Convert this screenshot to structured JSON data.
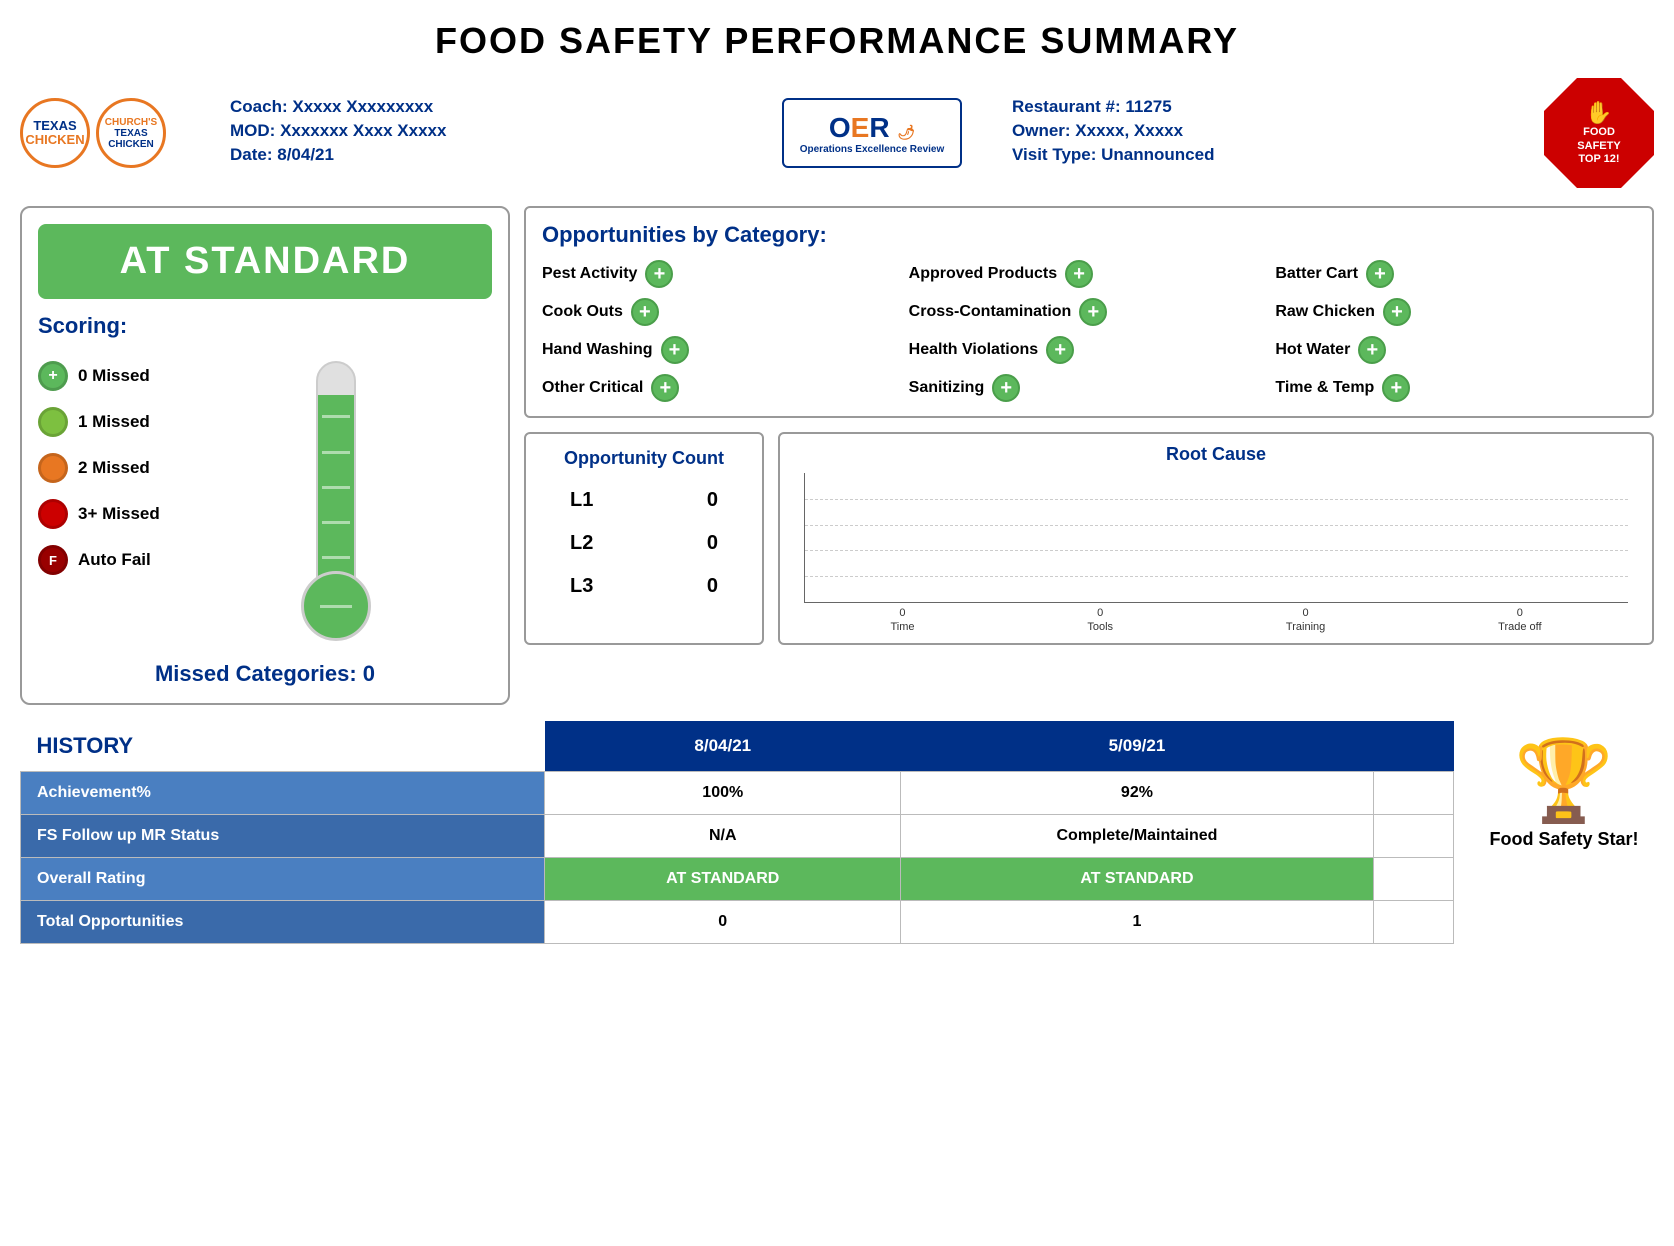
{
  "page": {
    "title": "FOOD SAFETY PERFORMANCE SUMMARY"
  },
  "header": {
    "coach_label": "Coach:",
    "coach_value": "Xxxxx Xxxxxxxxx",
    "mod_label": "MOD:",
    "mod_value": "Xxxxxxx Xxxx Xxxxx",
    "date_label": "Date:",
    "date_value": "8/04/21",
    "restaurant_label": "Restaurant #:",
    "restaurant_value": "11275",
    "owner_label": "Owner:",
    "owner_value": "Xxxxx, Xxxxx",
    "visit_label": "Visit Type:",
    "visit_value": "Unannounced",
    "badge_line1": "FOOD",
    "badge_line2": "SAFETY",
    "badge_line3": "TOP 12!",
    "oer_label": "Operations Excellence Review"
  },
  "left_panel": {
    "status": "AT STANDARD",
    "scoring_label": "Scoring:",
    "legend": [
      {
        "label": "0 Missed",
        "color": "green",
        "symbol": "+"
      },
      {
        "label": "1 Missed",
        "color": "lime",
        "symbol": ""
      },
      {
        "label": "2 Missed",
        "color": "orange",
        "symbol": ""
      },
      {
        "label": "3+ Missed",
        "color": "red",
        "symbol": ""
      },
      {
        "label": "Auto Fail",
        "color": "darkred",
        "symbol": "F"
      }
    ],
    "missed_categories_label": "Missed Categories:",
    "missed_categories_value": "0"
  },
  "opportunities": {
    "title": "Opportunities by Category:",
    "items": [
      "Pest Activity",
      "Approved Products",
      "Batter Cart",
      "Cook Outs",
      "Cross-Contamination",
      "Raw Chicken",
      "Hand Washing",
      "Health Violations",
      "Hot Water",
      "Other Critical",
      "Sanitizing",
      "Time & Temp"
    ]
  },
  "opportunity_count": {
    "title": "Opportunity Count",
    "rows": [
      {
        "label": "L1",
        "value": "0"
      },
      {
        "label": "L2",
        "value": "0"
      },
      {
        "label": "L3",
        "value": "0"
      }
    ]
  },
  "root_cause": {
    "title": "Root Cause",
    "x_labels": [
      "Time",
      "Tools",
      "Training",
      "Trade off"
    ],
    "x_values": [
      "0",
      "0",
      "0",
      "0"
    ]
  },
  "history": {
    "label": "HISTORY",
    "columns": [
      "8/04/21",
      "5/09/21",
      ""
    ],
    "rows": [
      {
        "label": "Achievement%",
        "values": [
          "100%",
          "92%",
          ""
        ]
      },
      {
        "label": "FS Follow up MR Status",
        "values": [
          "N/A",
          "Complete/Maintained",
          ""
        ]
      },
      {
        "label": "Overall Rating",
        "values": [
          "AT STANDARD",
          "AT STANDARD",
          ""
        ],
        "highlight": true
      },
      {
        "label": "Total Opportunities",
        "values": [
          "0",
          "1",
          ""
        ]
      }
    ]
  },
  "trophy": {
    "label": "Food Safety Star!"
  }
}
